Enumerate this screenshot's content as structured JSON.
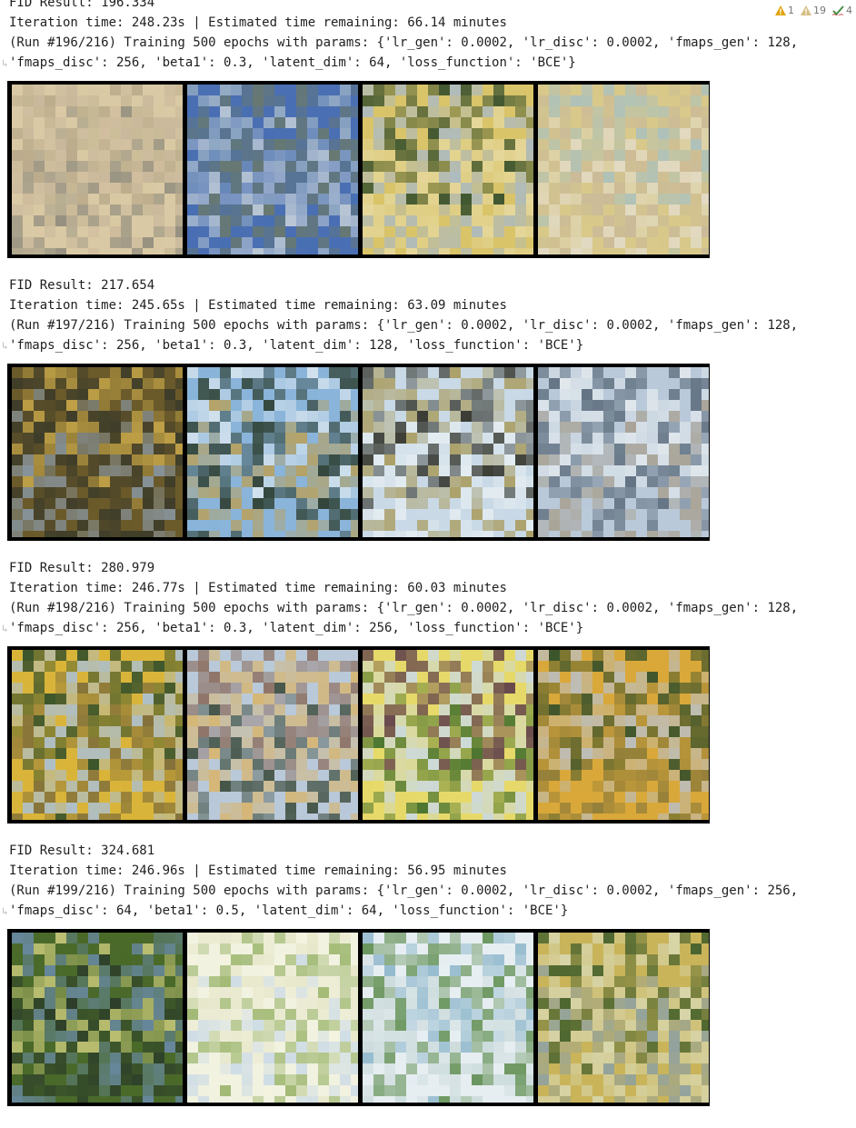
{
  "inspections": {
    "errors": "1",
    "warnings": "19",
    "typos": "4",
    "error_color": "#e0a40c",
    "warning_color": "#c9a95a",
    "ok_color": "#4a8f4a"
  },
  "blocks": [
    {
      "fid_line": "FID Result: 196.334",
      "time_line": "Iteration time: 248.23s | Estimated time remaining: 66.14 minutes",
      "run_line": "(Run #196/216) Training 500 epochs with params: {'lr_gen': 0.0002, 'lr_disc': 0.0002, 'fmaps_gen': 128,",
      "params_line": "'fmaps_disc': 256, 'beta1': 0.3, 'latent_dim': 64, 'loss_function': 'BCE'}",
      "tiles": [
        {
          "palette": [
            "#d9c9a4",
            "#b8a98a",
            "#c7b59a",
            "#8e8a7c"
          ]
        },
        {
          "palette": [
            "#4a6fb3",
            "#9fb4c7",
            "#6b7a6a",
            "#c9d3d9"
          ]
        },
        {
          "palette": [
            "#d9c46a",
            "#2f4a2a",
            "#a8b9c9",
            "#e6d9a0"
          ]
        },
        {
          "palette": [
            "#d8c98a",
            "#a8c0c0",
            "#c9b99a",
            "#e3dccb"
          ]
        }
      ]
    },
    {
      "fid_line": "FID Result: 217.654",
      "time_line": "Iteration time: 245.65s | Estimated time remaining: 63.09 minutes",
      "run_line": "(Run #197/216) Training 500 epochs with params: {'lr_gen': 0.0002, 'lr_disc': 0.0002, 'fmaps_gen': 128,",
      "params_line": "'fmaps_disc': 256, 'beta1': 0.3, 'latent_dim': 128, 'loss_function': 'BCE'}",
      "tiles": [
        {
          "palette": [
            "#6b5a2a",
            "#c9a94a",
            "#3a3a2a",
            "#8a9aa8"
          ]
        },
        {
          "palette": [
            "#8ab4d9",
            "#d9e6ef",
            "#2a3a2a",
            "#b9a05a"
          ]
        },
        {
          "palette": [
            "#c9d9e6",
            "#2a2a1f",
            "#a89a5a",
            "#e6eef2"
          ]
        },
        {
          "palette": [
            "#b9c9d9",
            "#e6ecef",
            "#5a6a7a",
            "#a8a090"
          ]
        }
      ]
    },
    {
      "fid_line": "FID Result: 280.979",
      "time_line": "Iteration time: 246.77s | Estimated time remaining: 60.03 minutes",
      "run_line": "(Run #198/216) Training 500 epochs with params: {'lr_gen': 0.0002, 'lr_disc': 0.0002, 'fmaps_gen': 128,",
      "params_line": "'fmaps_disc': 256, 'beta1': 0.3, 'latent_dim': 256, 'loss_function': 'BCE'}",
      "tiles": [
        {
          "palette": [
            "#d9b43a",
            "#2a4a2a",
            "#a8c0d9",
            "#7a6a3a"
          ]
        },
        {
          "palette": [
            "#b9c9d9",
            "#8a6a5a",
            "#d9b46a",
            "#3a4a3a"
          ]
        },
        {
          "palette": [
            "#e6d96a",
            "#5a3a4a",
            "#c9d9e6",
            "#3a6a2a"
          ]
        },
        {
          "palette": [
            "#d9a83a",
            "#2a4a2a",
            "#b9c0c9",
            "#8a7a3a"
          ]
        }
      ]
    },
    {
      "fid_line": "FID Result: 324.681",
      "time_line": "Iteration time: 246.96s | Estimated time remaining: 56.95 minutes",
      "run_line": "(Run #199/216) Training 500 epochs with params: {'lr_gen': 0.0002, 'lr_disc': 0.0002, 'fmaps_gen': 256,",
      "params_line": "'fmaps_disc': 64, 'beta1': 0.5, 'latent_dim': 64, 'loss_function': 'BCE'}",
      "tiles": [
        {
          "palette": [
            "#4a6a2a",
            "#c9c97a",
            "#6a8aa8",
            "#2a3a2a"
          ]
        },
        {
          "palette": [
            "#f2f2e0",
            "#e6e6c9",
            "#9ab46a",
            "#c9d9e6"
          ]
        },
        {
          "palette": [
            "#e6eef2",
            "#8ab4c9",
            "#5a8a4a",
            "#c9d9d9"
          ]
        },
        {
          "palette": [
            "#c9b45a",
            "#3a5a2a",
            "#d9d9b4",
            "#8aa0a8"
          ]
        }
      ]
    }
  ]
}
